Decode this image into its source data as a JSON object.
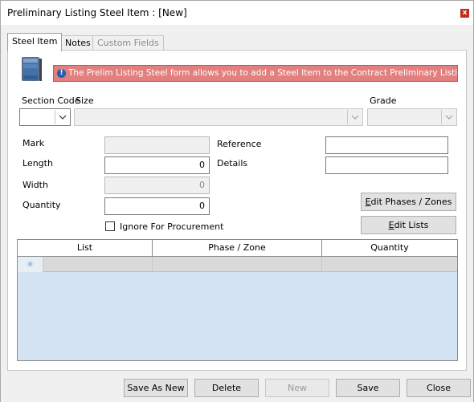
{
  "window": {
    "title": "Preliminary Listing Steel Item : [New]",
    "close_glyph": "x"
  },
  "tabs": [
    {
      "label": "Steel Item",
      "active": true,
      "enabled": true
    },
    {
      "label": "Notes",
      "active": false,
      "enabled": true
    },
    {
      "label": "Custom Fields",
      "active": false,
      "enabled": false
    }
  ],
  "banner": {
    "icon": "info-icon",
    "icon_glyph": "!",
    "text": "The Prelim Listing Steel form allows you to add a Steel Item to the Contract Preliminary Listing.",
    "color": "#e27f7f"
  },
  "header_icon": "database-stack-icon",
  "fields": {
    "section_code_label": "Section Code",
    "size_label": "Size",
    "grade_label": "Grade",
    "mark_label": "Mark",
    "mark_value": "",
    "length_label": "Length",
    "length_value": "0",
    "width_label": "Width",
    "width_value": "0",
    "quantity_label": "Quantity",
    "quantity_value": "0",
    "reference_label": "Reference",
    "reference_value": "",
    "details_label": "Details",
    "details_value": "",
    "ignore_label": "Ignore For Procurement",
    "ignore_checked": false
  },
  "side_buttons": {
    "edit_phases_prefix": "E",
    "edit_phases_rest": "dit Phases / Zones",
    "edit_lists_prefix": "E",
    "edit_lists_rest": "dit Lists"
  },
  "grid": {
    "columns": [
      "List",
      "Phase / Zone",
      "Quantity"
    ],
    "new_row_glyph": "✳"
  },
  "footer": {
    "save_as_new": "Save As New",
    "delete": "Delete",
    "new": "New",
    "save": "Save",
    "close": "Close"
  }
}
